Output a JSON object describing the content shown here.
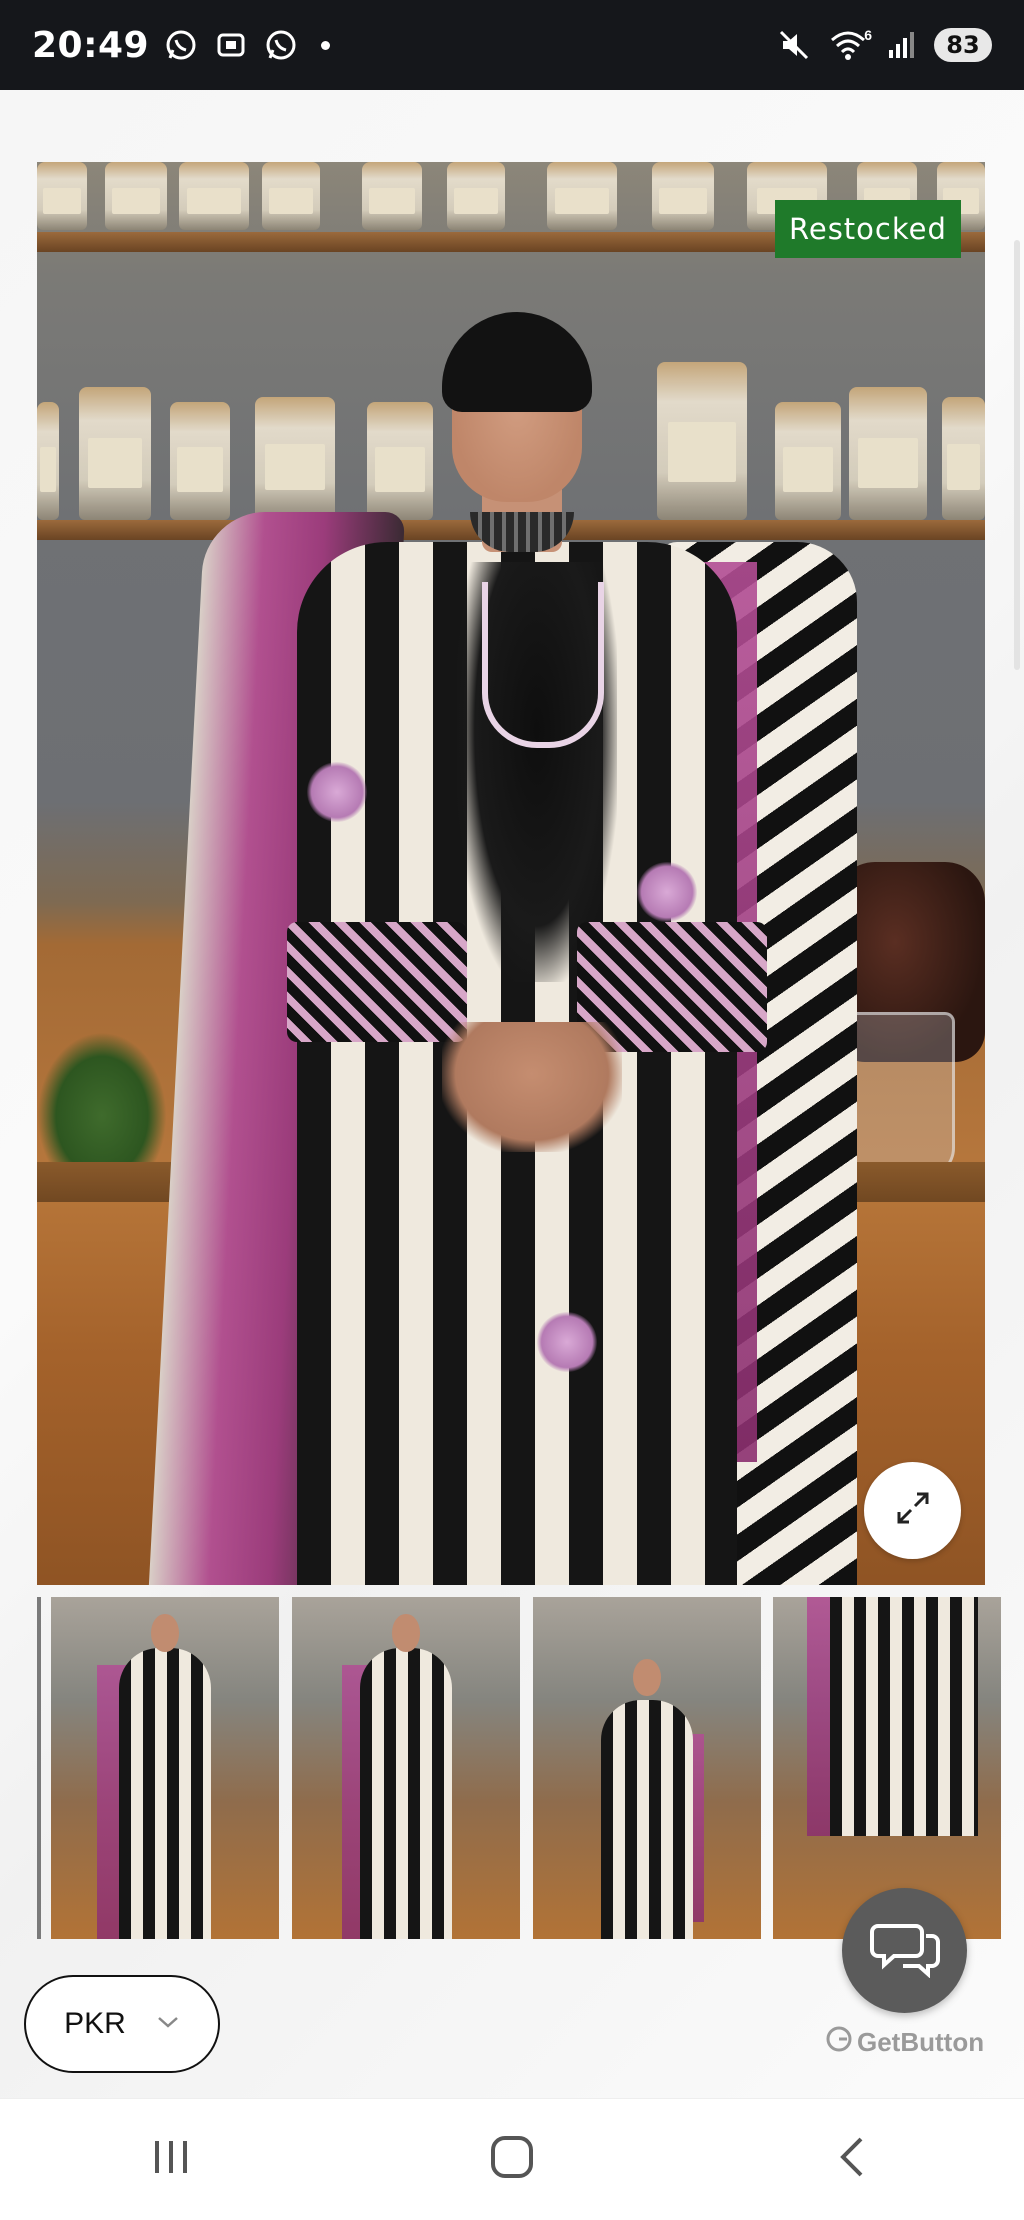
{
  "status_bar": {
    "time": "20:49",
    "icons_left": [
      "whatsapp-icon",
      "screen-record-icon",
      "whatsapp-business-icon",
      "notification-dot"
    ],
    "icons_right": [
      "mute-icon",
      "wifi-icon",
      "signal-icon"
    ],
    "wifi_label": "6",
    "battery": "83"
  },
  "product": {
    "badge": "Restocked",
    "expand_icon": "expand-icon",
    "thumbnails": [
      {
        "name": "thumbnail-1"
      },
      {
        "name": "thumbnail-2"
      },
      {
        "name": "thumbnail-3"
      },
      {
        "name": "thumbnail-4"
      }
    ]
  },
  "currency": {
    "selected": "PKR",
    "icon": "chevron-down-icon"
  },
  "chat": {
    "icon": "chat-bubbles-icon",
    "brand": "GetButton"
  },
  "nav": {
    "buttons": [
      "recents-button",
      "home-button",
      "back-button"
    ]
  },
  "colors": {
    "badge_bg": "#1f7a2a",
    "status_bar_bg": "#15171b",
    "chat_btn_bg": "#5b5b5b"
  }
}
